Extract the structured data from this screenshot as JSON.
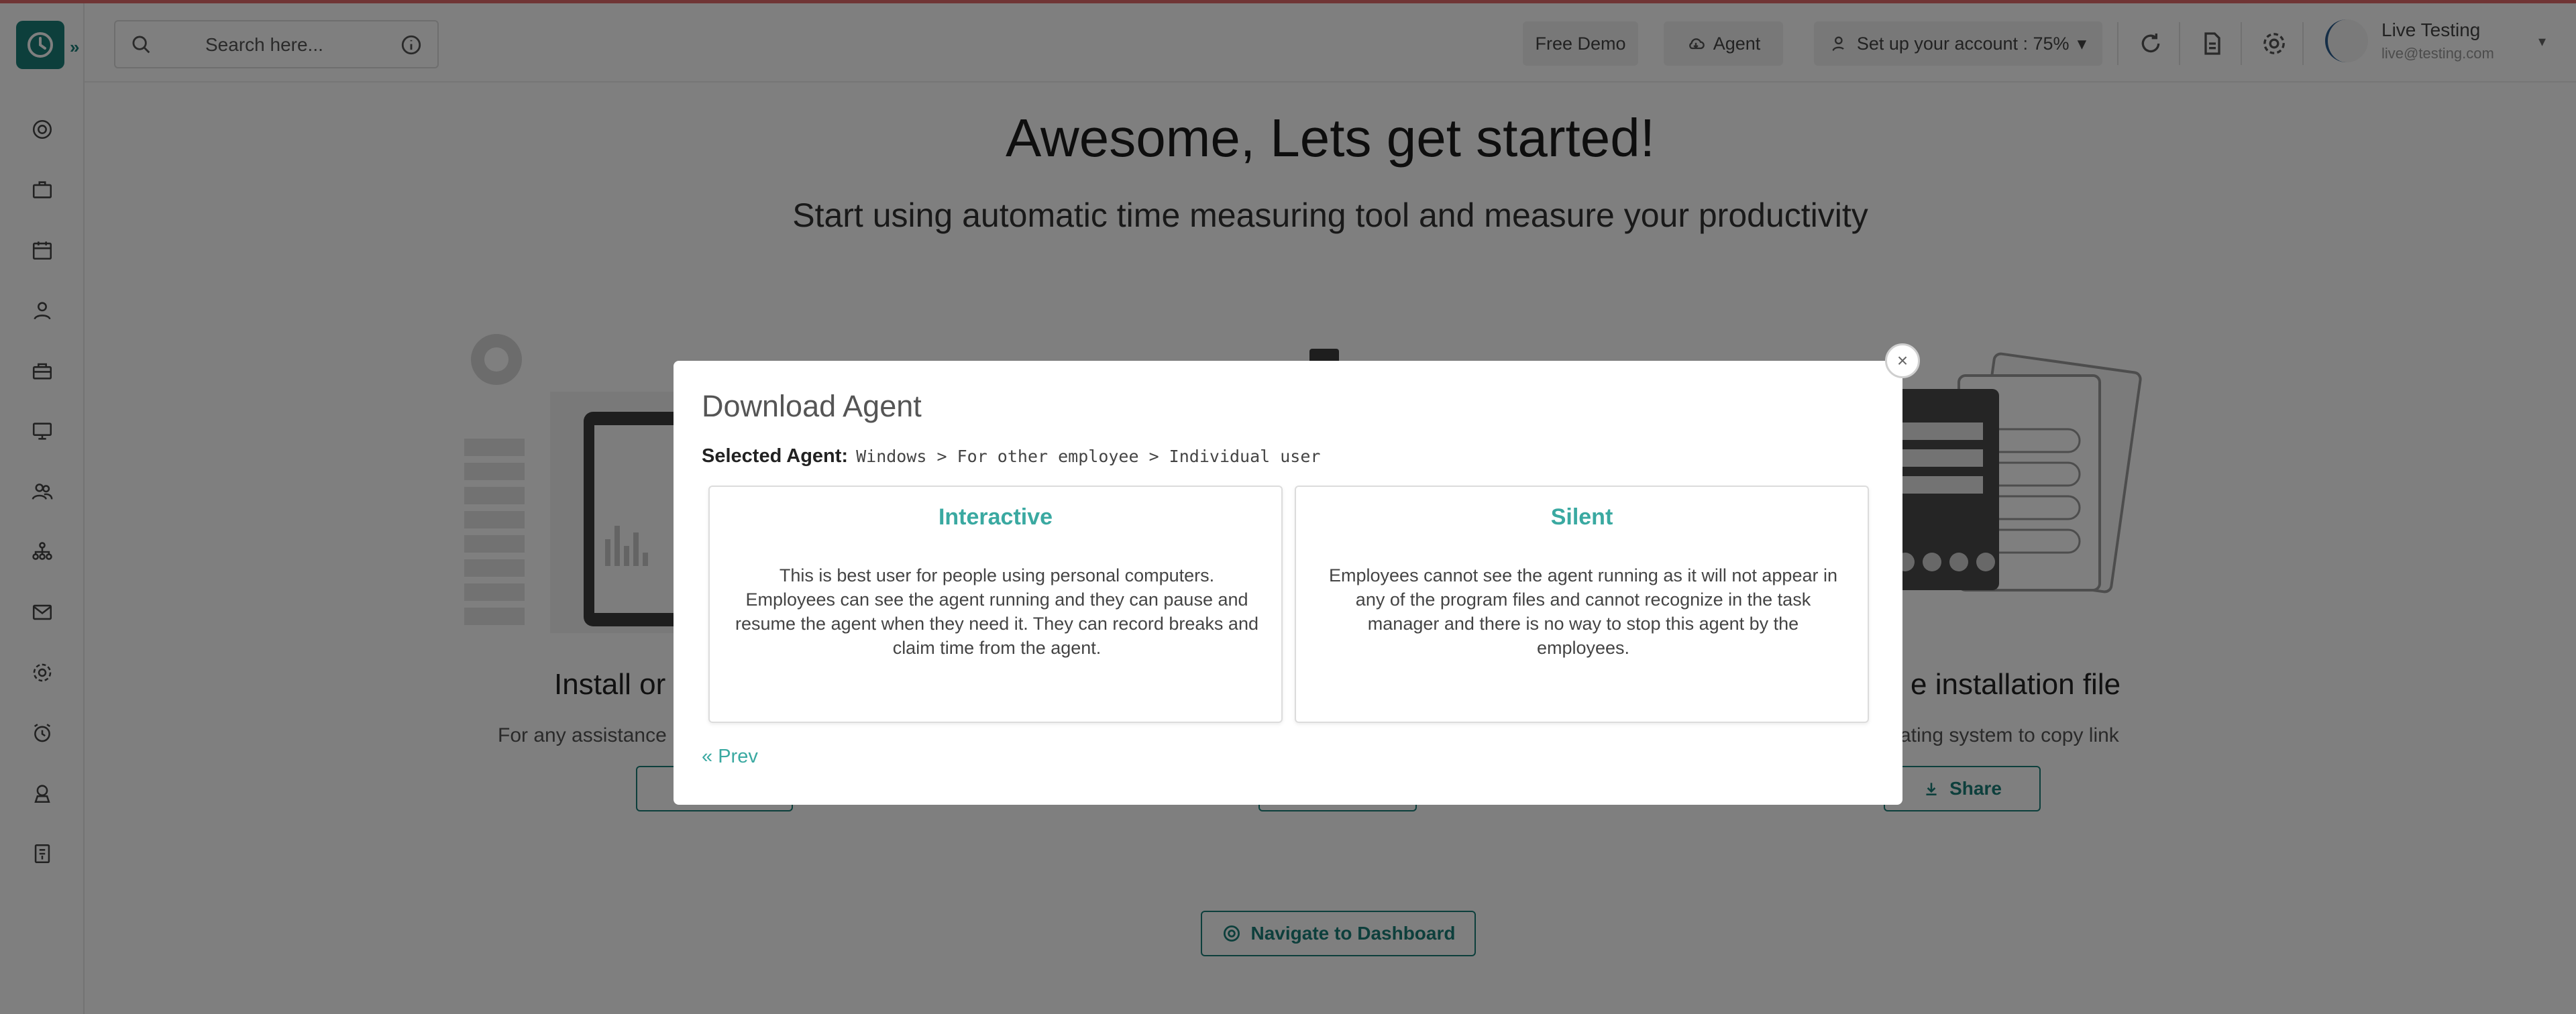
{
  "header": {
    "search_placeholder": "Search here...",
    "free_demo": "Free Demo",
    "agent": "Agent",
    "setup": "Set up your account : 75%",
    "user_name": "Live Testing",
    "user_email": "live@testing.com"
  },
  "sidebar": {
    "icons": [
      "dashboard-icon",
      "briefcase-icon",
      "calendar-icon",
      "user-icon",
      "toolbox-icon",
      "monitor-icon",
      "users-icon",
      "org-chart-icon",
      "mail-icon",
      "settings-icon",
      "alarm-icon",
      "badge-icon",
      "report-icon"
    ]
  },
  "main": {
    "title": "Awesome, Lets get started!",
    "subtitle": "Start using automatic time measuring tool and measure your productivity",
    "left_title": "Install or",
    "left_text": "For any assistance",
    "right_title": "e installation file",
    "right_text": "ating system to copy link",
    "share_label": "Share",
    "navigate_label": "Navigate to Dashboard"
  },
  "modal": {
    "title": "Download Agent",
    "selected_label": "Selected Agent:",
    "selected_value": "Windows > For other employee > Individual user",
    "close_symbol": "×",
    "prev_label": "Prev",
    "cards": [
      {
        "title": "Interactive",
        "text": "This is best user for people using personal computers. Employees can see the agent running and they can pause and resume the agent when they need it. They can record breaks and claim time from the agent."
      },
      {
        "title": "Silent",
        "text": "Employees cannot see the agent running as it will not appear in any of the program files and cannot recognize in the task manager and there is no way to stop this agent by the employees."
      }
    ]
  },
  "colors": {
    "brand": "#1a7f78",
    "accent_text": "#3aa9a1",
    "overlay": "rgba(0,0,0,0.5)"
  }
}
